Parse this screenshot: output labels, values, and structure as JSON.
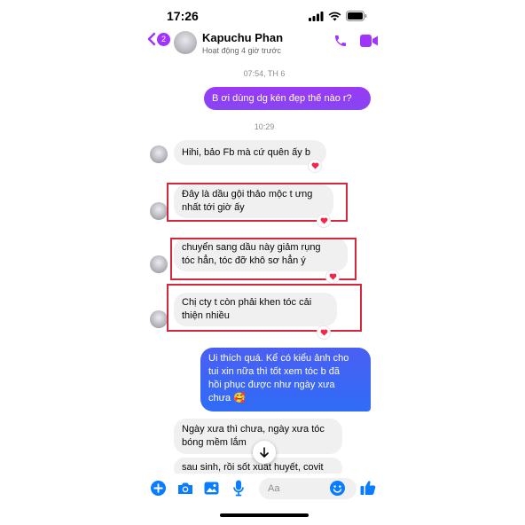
{
  "status_bar": {
    "time": "17:26"
  },
  "header": {
    "unread_count": "2",
    "contact_name": "Kapuchu Phan",
    "contact_status": "Hoạt động 4 giờ trước",
    "icons": [
      "chevron-left-icon",
      "phone-icon",
      "video-camera-icon"
    ]
  },
  "thread": {
    "timestamp_1": "07:54, TH 6",
    "outgoing_1": "B ơi dùng dg kén đẹp thế nào r?",
    "timestamp_2": "10:29",
    "incoming_1": "Hihi, bảo Fb mà cứ quên ấy b",
    "incoming_2_line1": "Đây là dầu gội thảo mộc t ưng",
    "incoming_2_line2": "nhất tới giờ ấy",
    "incoming_3_line1": "chuyển sang dầu này giảm rụng",
    "incoming_3_line2": "tóc hẳn, tóc đỡ khô sơ hẳn ý",
    "incoming_4_line1": "Chị cty t còn phải khen tóc cải",
    "incoming_4_line2": "thiện nhiều",
    "outgoing_2_line1": "Ui thích quá. Kể có kiểu ảnh cho",
    "outgoing_2_line2": "tui xin nữa thì tốt xem tóc b đã",
    "outgoing_2_line3": "hồi phục được như ngày xưa",
    "outgoing_2_line4": "chưa 🥰",
    "incoming_5_line1": "Ngày xưa thì chưa, ngày xưa tóc",
    "incoming_5_line2": "bóng mềm lắm",
    "incoming_6": "sau sinh, rồi sốt xuất huyết, covit",
    "reaction": "heart"
  },
  "composer": {
    "placeholder": "Aa",
    "icons": [
      "plus-icon",
      "camera-icon",
      "image-icon",
      "microphone-icon",
      "emoji-icon",
      "thumbs-up-icon"
    ]
  },
  "colors": {
    "accent_purple": "#a033ff",
    "bubble_gradient_top": "#8b3cf5",
    "bubble_gradient_bottom": "#2f6cf6",
    "composer_blue": "#0a7cff",
    "highlight_red": "#d4273c",
    "heart_red": "#f02849"
  }
}
